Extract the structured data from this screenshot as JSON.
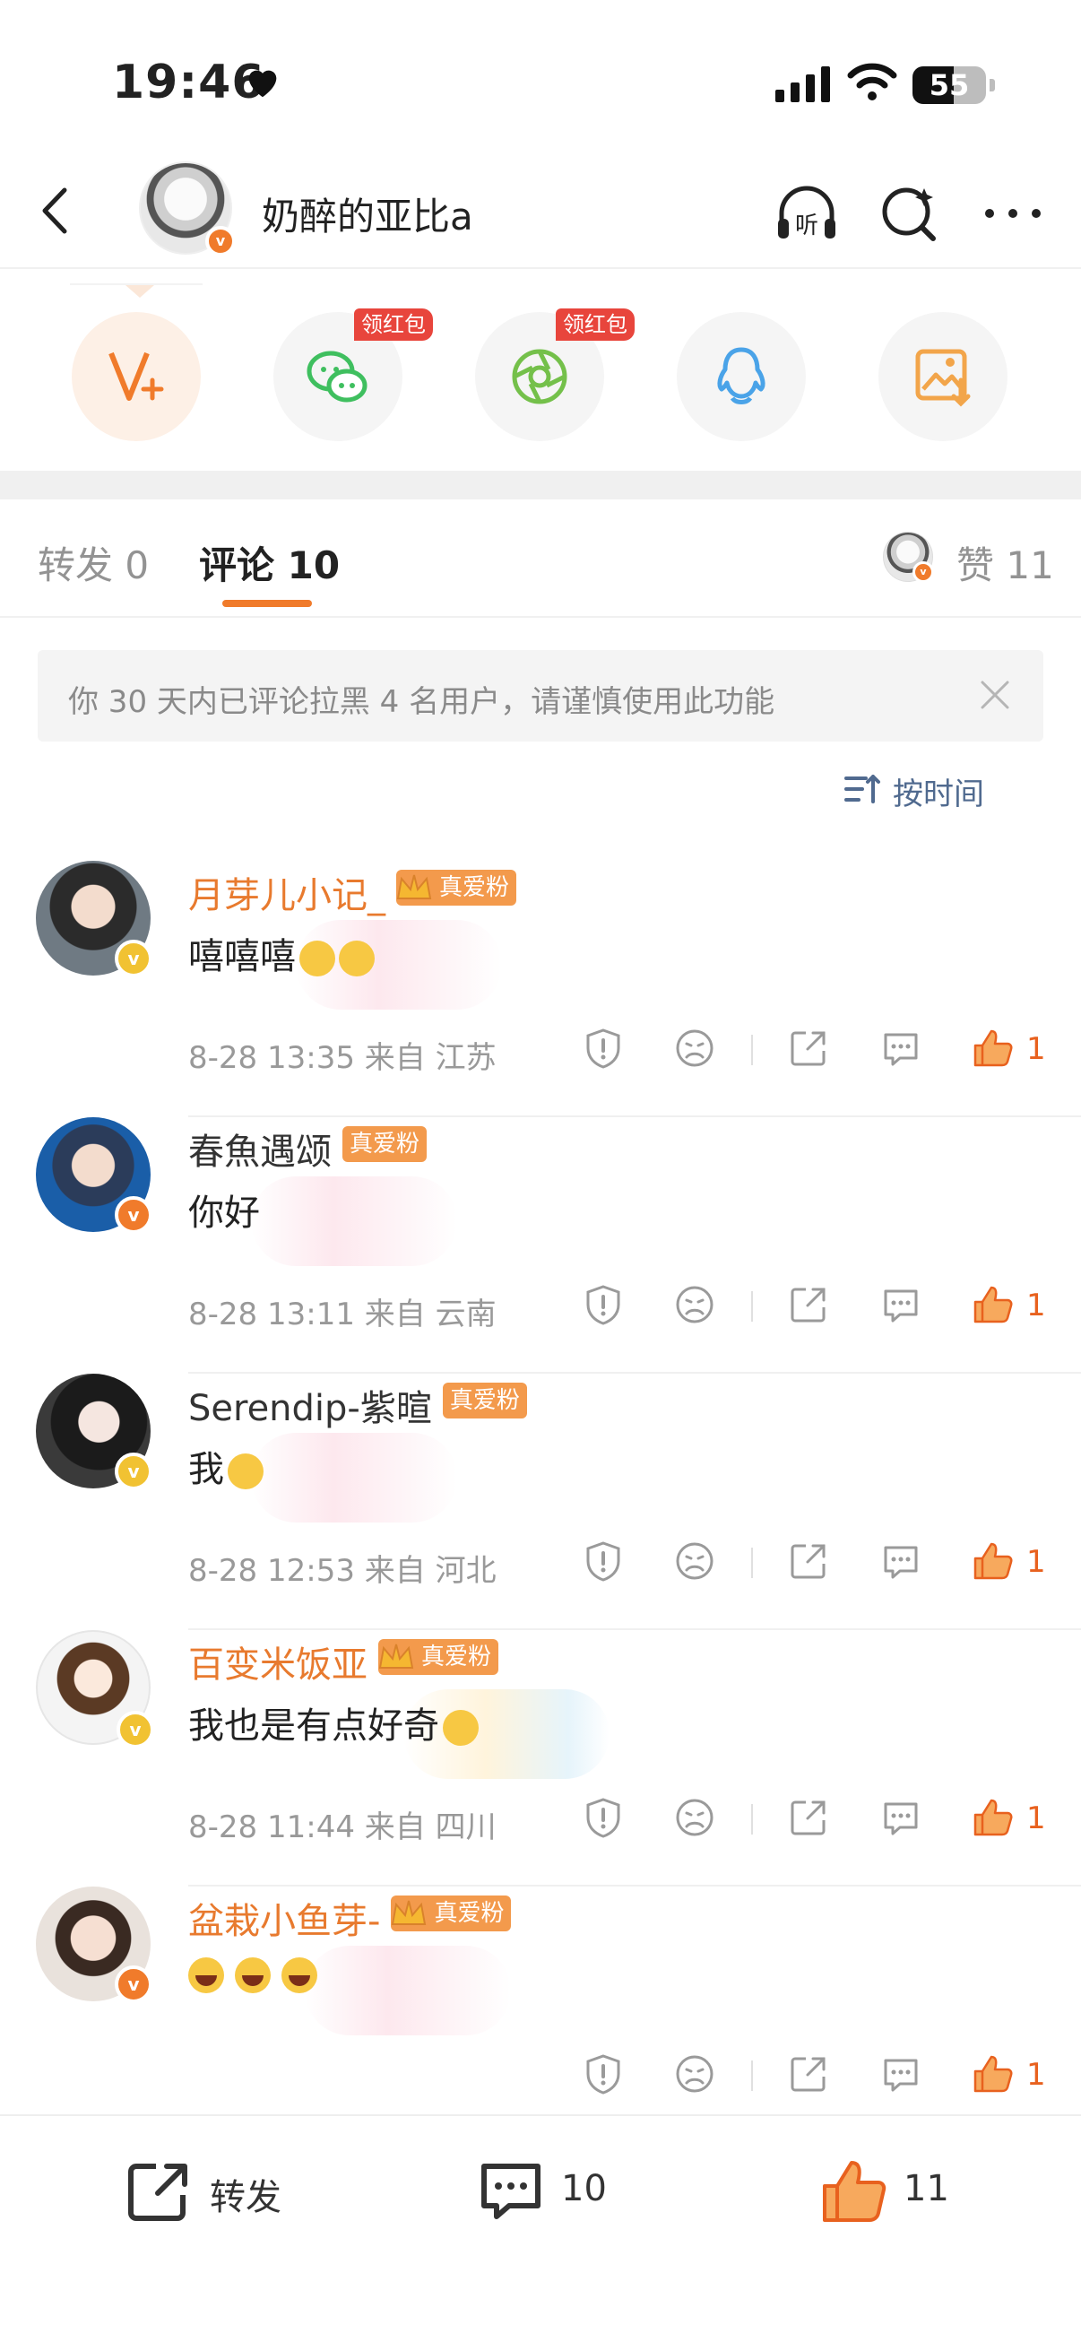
{
  "status_bar": {
    "time": "19:46",
    "battery": "55"
  },
  "header": {
    "username": "奶醉的亚比a",
    "verified_mark": "v",
    "icons": [
      "back-icon",
      "listen-icon",
      "search-icon",
      "more-icon"
    ],
    "listen_label": "听"
  },
  "share": {
    "buttons": [
      {
        "name": "vplus",
        "icon": "vplus-icon"
      },
      {
        "name": "wechat",
        "icon": "wechat-icon",
        "tag": "领红包"
      },
      {
        "name": "moments",
        "icon": "moments-icon",
        "tag": "领红包"
      },
      {
        "name": "qq",
        "icon": "qq-icon"
      },
      {
        "name": "save-image",
        "icon": "save-image-icon"
      }
    ]
  },
  "tabs": {
    "repost": "转发 0",
    "comments": "评论 10",
    "likes": "赞 11"
  },
  "notice": {
    "text": "你 30 天内已评论拉黑 4 名用户，请谨慎使用此功能"
  },
  "sort": {
    "label": "按时间"
  },
  "comments": [
    {
      "name": "月芽儿小记_",
      "badge": "真爱粉",
      "text": "嘻嘻嘻",
      "emoji_count": 2,
      "time": "8-28 13:35 来自 江苏",
      "likes": "1"
    },
    {
      "name": "春魚遇颂",
      "badge": "真爱粉",
      "text": "你好",
      "emoji_count": 0,
      "time": "8-28 13:11 来自 云南",
      "likes": "1"
    },
    {
      "name": "Serendip-紫暄",
      "badge": "真爱粉",
      "text": "我",
      "emoji_count": 1,
      "time": "8-28 12:53 来自 河北",
      "likes": "1"
    },
    {
      "name": "百变米饭亚",
      "badge": "真爱粉",
      "text": "我也是有点好奇",
      "emoji_count": 1,
      "time": "8-28 11:44 来自 四川",
      "likes": "1"
    },
    {
      "name": "盆栽小鱼芽-",
      "badge": "真爱粉",
      "text": "",
      "emoji_count": 3,
      "time": "",
      "likes": "1"
    }
  ],
  "bottom_bar": {
    "repost": "转发",
    "comments": "10",
    "likes": "11"
  },
  "colors": {
    "accent": "#f07b2b",
    "like": "#e8611e",
    "badge": "#f39a4c",
    "link": "#506a8f",
    "red_tag": "#e8453c"
  }
}
